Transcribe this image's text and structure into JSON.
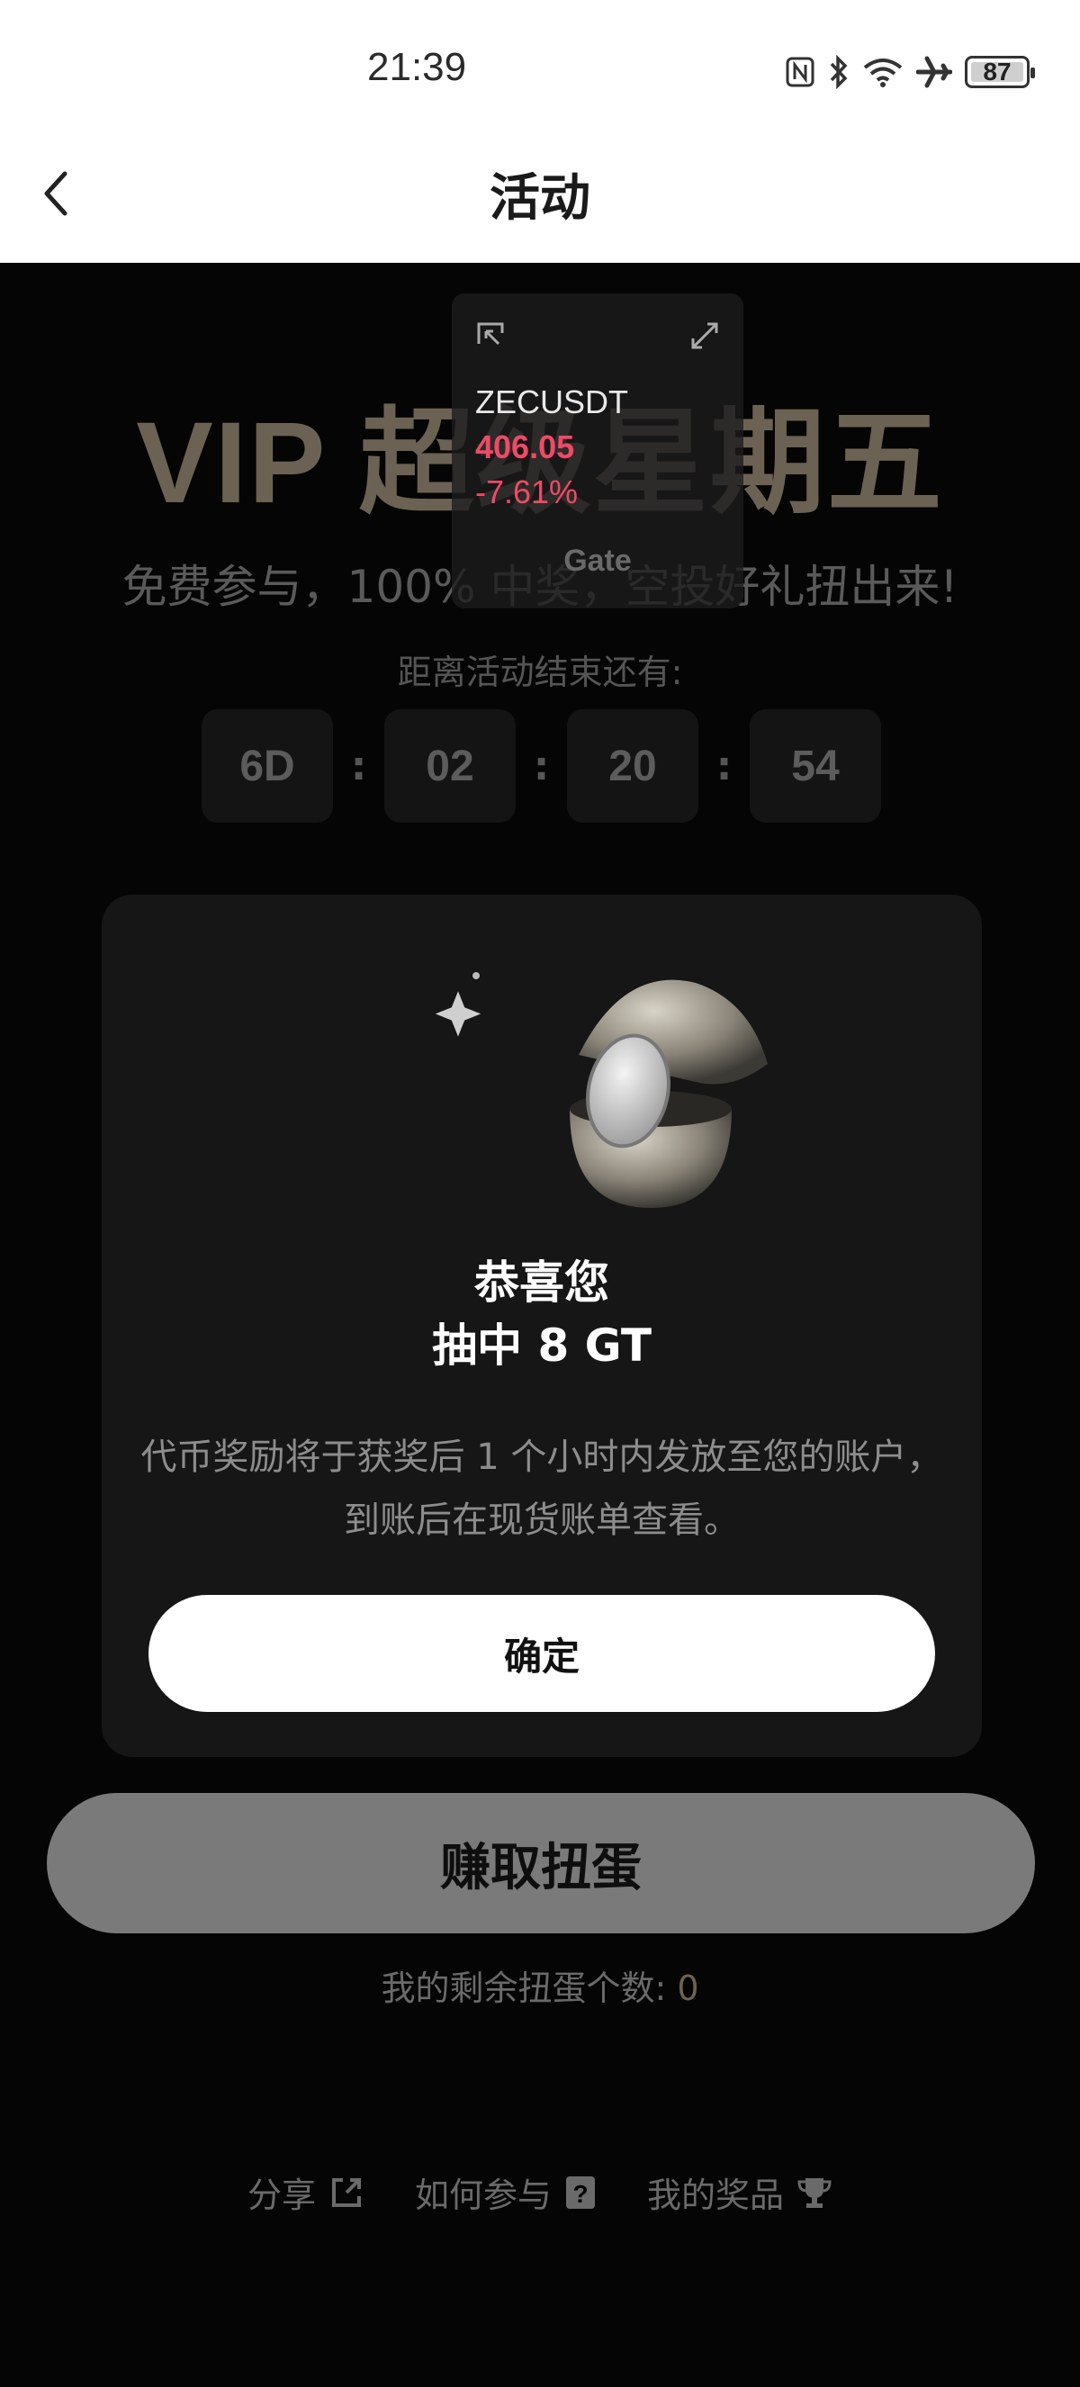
{
  "status_bar": {
    "time": "21:39",
    "battery": "87"
  },
  "header": {
    "title": "活动"
  },
  "hero": {
    "title": "VIP 超级星期五",
    "subtitle": "免费参与，100% 中奖，空投好礼扭出来!",
    "countdown_label": "距离活动结束还有:",
    "countdown": {
      "days": "6D",
      "hours": "02",
      "minutes": "20",
      "seconds": "54",
      "separator": ":"
    }
  },
  "ticker": {
    "symbol": "ZECUSDT",
    "price": "406.05",
    "change": "-7.61%",
    "brand": "Gate",
    "color": "#ef4a66"
  },
  "modal": {
    "title_line1": "恭喜您",
    "title_line2": "抽中 8 GT",
    "description": "代币奖励将于获奖后 1 个小时内发放至您的账户，到账后在现货账单查看。",
    "confirm_label": "确定"
  },
  "earn_button": {
    "label": "赚取扭蛋"
  },
  "remaining": {
    "label": "我的剩余扭蛋个数:",
    "count": "0"
  },
  "links": [
    {
      "label": "分享",
      "icon": "share-icon"
    },
    {
      "label": "如何参与",
      "icon": "question-icon"
    },
    {
      "label": "我的奖品",
      "icon": "trophy-icon"
    }
  ],
  "colors": {
    "background": "#050505",
    "card": "#161616",
    "accent_gold": "#6b6253",
    "negative": "#ef4a66"
  }
}
